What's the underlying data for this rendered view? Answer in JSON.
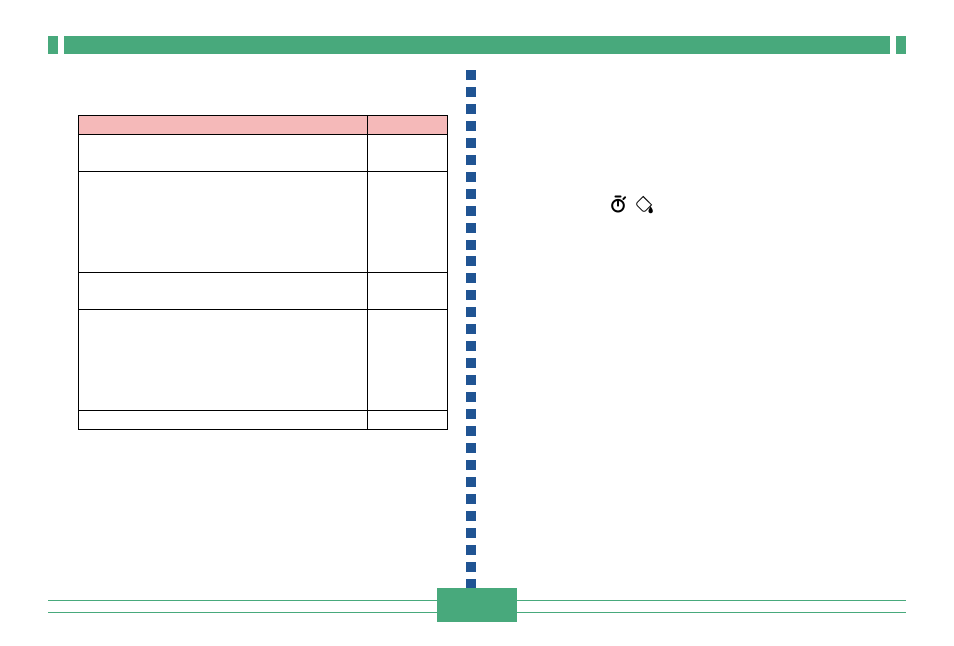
{
  "colors": {
    "accent_green": "#48a97c",
    "header_pink": "#f5b9b9",
    "separator_blue": "#205493",
    "rule_black": "#000000"
  },
  "top_bar": {
    "segments": [
      "cap",
      "main",
      "cap"
    ]
  },
  "separator": {
    "orientation": "vertical",
    "style": "dotted-squares"
  },
  "table": {
    "headers": [
      "",
      ""
    ],
    "rows": [
      [
        "",
        ""
      ],
      [
        "",
        ""
      ],
      [
        "",
        ""
      ],
      [
        "",
        ""
      ],
      [
        "",
        ""
      ]
    ]
  },
  "icons": {
    "timer_label": "timer-icon",
    "paint_label": "paint-bucket-icon"
  },
  "page_number": ""
}
